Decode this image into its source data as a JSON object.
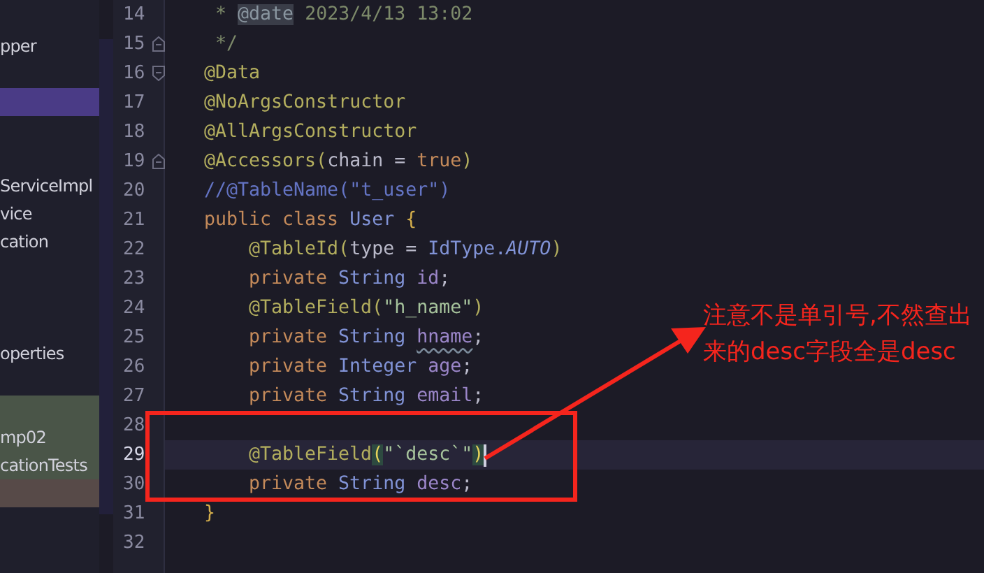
{
  "sidebar": {
    "items": [
      {
        "label": "pper",
        "selected": false
      },
      {
        "selected": false
      },
      {
        "selected": true
      },
      {
        "selected": false
      },
      {
        "selected": false
      },
      {
        "label": "ServiceImpl",
        "selected": false
      },
      {
        "label": "vice",
        "selected": false
      },
      {
        "label": "cation",
        "selected": false
      },
      {
        "selected": false
      },
      {
        "selected": false
      },
      {
        "selected": false
      },
      {
        "label": "operties",
        "selected": false
      },
      {
        "selected": false
      },
      {
        "selected": false,
        "kind": "added"
      },
      {
        "label": "mp02",
        "selected": false,
        "kind": "added"
      },
      {
        "label": "cationTests",
        "selected": false,
        "kind": "added"
      },
      {
        "selected": false,
        "kind": "modified"
      }
    ]
  },
  "editor": {
    "lines": [
      {
        "number": "14",
        "current": false,
        "caret": false,
        "tokens": [
          {
            "kind": "doc-comment",
            "text": " * "
          },
          {
            "kind": "doc-tag",
            "text": "@date"
          },
          {
            "kind": "doc-comment",
            "text": " 2023/4/13 13:02"
          }
        ]
      },
      {
        "number": "15",
        "current": false,
        "caret": false,
        "kind": "fold-end",
        "tokens": [
          {
            "kind": "doc-comment",
            "text": " */"
          }
        ]
      },
      {
        "number": "16",
        "current": false,
        "caret": false,
        "kind": "fold-start",
        "tokens": [
          {
            "kind": "annotation",
            "text": "@Data"
          }
        ]
      },
      {
        "number": "17",
        "current": false,
        "caret": false,
        "tokens": [
          {
            "kind": "annotation",
            "text": "@NoArgsConstructor"
          }
        ]
      },
      {
        "number": "18",
        "current": false,
        "caret": false,
        "tokens": [
          {
            "kind": "annotation",
            "text": "@AllArgsConstructor"
          }
        ]
      },
      {
        "number": "19",
        "current": false,
        "caret": false,
        "kind": "fold-end",
        "tokens": [
          {
            "kind": "annotation",
            "text": "@Accessors("
          },
          {
            "kind": "plain",
            "text": "chain = "
          },
          {
            "kind": "keyword",
            "text": "true"
          },
          {
            "kind": "annotation",
            "text": ")"
          }
        ]
      },
      {
        "number": "20",
        "current": false,
        "caret": false,
        "tokens": [
          {
            "kind": "comment",
            "text": "//@TableName(\"t_user\")"
          }
        ]
      },
      {
        "number": "21",
        "current": false,
        "caret": false,
        "tokens": [
          {
            "kind": "keyword",
            "text": "public class "
          },
          {
            "kind": "type",
            "text": "User "
          },
          {
            "kind": "brace",
            "text": "{"
          }
        ],
        "children": [
          {
            "number": "22",
            "current": false,
            "caret": false,
            "tokens": [
              {
                "kind": "annotation",
                "text": "@TableId("
              },
              {
                "kind": "plain",
                "text": "type = "
              },
              {
                "kind": "type",
                "text": "IdType."
              },
              {
                "kind": "constant",
                "text": "AUTO"
              },
              {
                "kind": "annotation",
                "text": ")"
              }
            ]
          },
          {
            "number": "23",
            "current": false,
            "caret": false,
            "tokens": [
              {
                "kind": "keyword",
                "text": "private "
              },
              {
                "kind": "type",
                "text": "String "
              },
              {
                "kind": "field",
                "text": "id"
              },
              {
                "kind": "plain",
                "text": ";"
              }
            ]
          },
          {
            "number": "24",
            "current": false,
            "caret": false,
            "tokens": [
              {
                "kind": "annotation",
                "text": "@TableField("
              },
              {
                "kind": "string",
                "text": "\"h_name\""
              },
              {
                "kind": "annotation",
                "text": ")"
              }
            ]
          },
          {
            "number": "25",
            "current": false,
            "caret": false,
            "tokens": [
              {
                "kind": "keyword",
                "text": "private "
              },
              {
                "kind": "type",
                "text": "String "
              },
              {
                "kind": "typo",
                "text": "hname"
              },
              {
                "kind": "plain",
                "text": ";"
              }
            ]
          },
          {
            "number": "26",
            "current": false,
            "caret": false,
            "tokens": [
              {
                "kind": "keyword",
                "text": "private "
              },
              {
                "kind": "type",
                "text": "Integer "
              },
              {
                "kind": "field",
                "text": "age"
              },
              {
                "kind": "plain",
                "text": ";"
              }
            ]
          },
          {
            "number": "27",
            "current": false,
            "caret": false,
            "tokens": [
              {
                "kind": "keyword",
                "text": "private "
              },
              {
                "kind": "type",
                "text": "String "
              },
              {
                "kind": "field",
                "text": "email"
              },
              {
                "kind": "plain",
                "text": ";"
              }
            ]
          },
          {
            "number": "28",
            "current": false,
            "caret": false
          },
          {
            "number": "29",
            "current": true,
            "caret": true,
            "tokens": [
              {
                "kind": "annotation",
                "text": "@TableField"
              },
              {
                "kind": "match",
                "text": "("
              },
              {
                "kind": "string",
                "text": "\"`desc`\""
              },
              {
                "kind": "match",
                "text": ")"
              }
            ]
          },
          {
            "number": "30",
            "current": false,
            "caret": false,
            "tokens": [
              {
                "kind": "keyword",
                "text": "private "
              },
              {
                "kind": "type",
                "text": "String "
              },
              {
                "kind": "field",
                "text": "desc"
              },
              {
                "kind": "plain",
                "text": ";"
              }
            ]
          }
        ]
      },
      {
        "number": "31",
        "current": false,
        "caret": false,
        "tokens": [
          {
            "kind": "brace",
            "text": "}"
          }
        ]
      },
      {
        "number": "32",
        "current": false,
        "caret": false
      }
    ]
  },
  "annotation": {
    "note": "注意不是单引号,不然查出来的desc字段全是desc"
  }
}
